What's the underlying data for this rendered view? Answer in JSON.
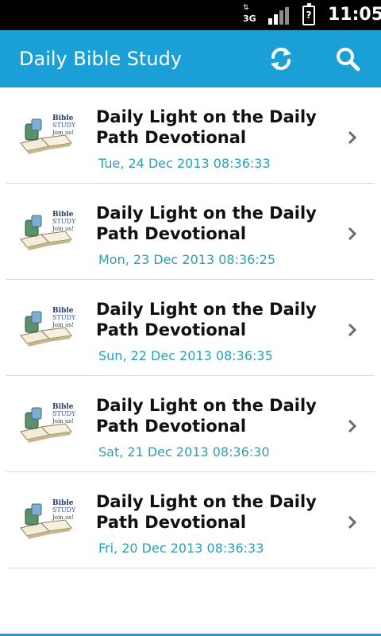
{
  "status_bar": {
    "network": "3G",
    "time": "11:05",
    "battery_label": "?"
  },
  "action_bar": {
    "title": "Daily Bible Study",
    "refresh_icon": "refresh-icon",
    "search_icon": "search-icon"
  },
  "thumbnail": {
    "text_lines": [
      "Bible",
      "STUDY",
      "Join us!"
    ]
  },
  "items": [
    {
      "title": "Daily Light on the Daily Path Devotional",
      "date": "Tue, 24 Dec 2013 08:36:33"
    },
    {
      "title": "Daily Light on the Daily Path Devotional",
      "date": "Mon, 23 Dec 2013 08:36:25"
    },
    {
      "title": "Daily Light on the Daily Path Devotional",
      "date": "Sun, 22 Dec 2013 08:36:35"
    },
    {
      "title": "Daily Light on the Daily Path Devotional",
      "date": "Sat, 21 Dec 2013 08:36:30"
    },
    {
      "title": "Daily Light on the Daily Path Devotional",
      "date": "Fri, 20 Dec 2013 08:36:33"
    }
  ],
  "colors": {
    "accent": "#1a9fd6",
    "date_text": "#2a9fb8"
  }
}
